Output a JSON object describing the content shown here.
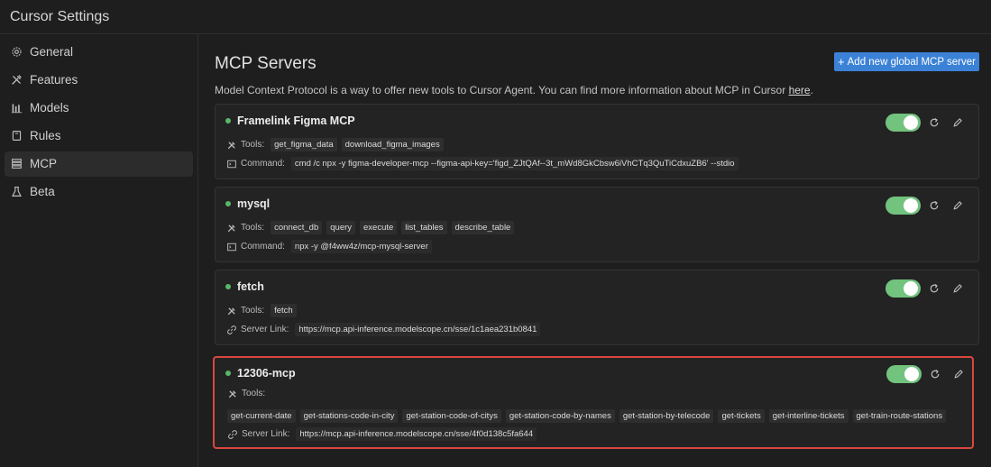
{
  "app": {
    "title": "Cursor Settings"
  },
  "sidebar": {
    "items": [
      {
        "label": "General",
        "icon": "gear-icon"
      },
      {
        "label": "Features",
        "icon": "tools-icon"
      },
      {
        "label": "Models",
        "icon": "bar-chart-icon"
      },
      {
        "label": "Rules",
        "icon": "book-icon"
      },
      {
        "label": "MCP",
        "icon": "server-icon",
        "active": true
      },
      {
        "label": "Beta",
        "icon": "flask-icon"
      }
    ]
  },
  "main": {
    "title": "MCP Servers",
    "add_button": "Add new global MCP server",
    "description": "Model Context Protocol is a way to offer new tools to Cursor Agent. You can find more information about MCP in Cursor",
    "description_link": "here",
    "description_end": "."
  },
  "servers": [
    {
      "name": "Framelink Figma MCP",
      "tools_label": "Tools:",
      "tools": [
        "get_figma_data",
        "download_figma_images"
      ],
      "detail_label": "Command:",
      "detail_value": "cmd /c npx -y figma-developer-mcp --figma-api-key='figd_ZJtQAf--3t_mWd8GkCbsw6iVhCTq3QuTiCdxuZB6' --stdio"
    },
    {
      "name": "mysql",
      "tools_label": "Tools:",
      "tools": [
        "connect_db",
        "query",
        "execute",
        "list_tables",
        "describe_table"
      ],
      "detail_label": "Command:",
      "detail_value": "npx -y @f4ww4z/mcp-mysql-server"
    },
    {
      "name": "fetch",
      "tools_label": "Tools:",
      "tools": [
        "fetch"
      ],
      "detail_label": "Server Link:",
      "detail_value": "https://mcp.api-inference.modelscope.cn/sse/1c1aea231b0841"
    },
    {
      "name": "12306-mcp",
      "tools_label": "Tools:",
      "tools": [
        "get-current-date",
        "get-stations-code-in-city",
        "get-station-code-of-citys",
        "get-station-code-by-names",
        "get-station-by-telecode",
        "get-tickets",
        "get-interline-tickets",
        "get-train-route-stations"
      ],
      "detail_label": "Server Link:",
      "detail_value": "https://mcp.api-inference.modelscope.cn/sse/4f0d138c5fa644"
    }
  ],
  "colors": {
    "accent": "#3b82d6",
    "toggle_on": "#72c37d",
    "status_dot": "#59b768",
    "highlight_border": "#d9473f"
  }
}
